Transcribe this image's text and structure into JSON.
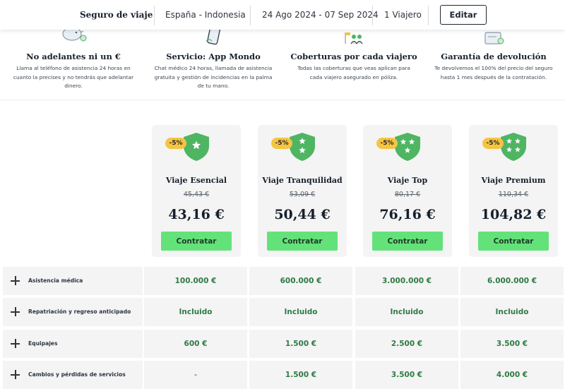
{
  "header": {
    "title": "Seguro de viaje",
    "destination": "España - Indonesia",
    "dates": "24 Ago 2024 - 07 Sep 2024",
    "travelers": "1  Viajero",
    "edit_label": "Editar"
  },
  "features": [
    {
      "icon": "piggy-bank-icon",
      "title": "No adelantes ni un €",
      "desc": "Llama al teléfono de asistencia 24 horas en cuanto la precises y no tendrás que adelantar dinero."
    },
    {
      "icon": "phone-icon",
      "title": "Servicio: App Mondo",
      "desc": "Chat médico 24 horas, llamada de asistencia gratuita y gestión de incidencias en la palma de tu mano."
    },
    {
      "icon": "travelers-icon",
      "title": "Coberturas por cada viajero",
      "desc": "Todas las coberturas que veas aplican para cada viajero asegurado en póliza."
    },
    {
      "icon": "refund-icon",
      "title": "Garantía de devolución",
      "desc": "Te devolvemos el 100% del precio del seguro hasta 1 mes después de la contratación."
    }
  ],
  "plans": [
    {
      "name": "Viaje Esencial",
      "badge": "-5%",
      "old_price": "45,43 €",
      "price": "43,16 €",
      "cta": "Contratar",
      "stars": 1
    },
    {
      "name": "Viaje Tranquilidad",
      "badge": "-5%",
      "old_price": "53,09 €",
      "price": "50,44 €",
      "cta": "Contratar",
      "stars": 2
    },
    {
      "name": "Viaje Top",
      "badge": "-5%",
      "old_price": "80,17 €",
      "price": "76,16 €",
      "cta": "Contratar",
      "stars": 3
    },
    {
      "name": "Viaje Premium",
      "badge": "-5%",
      "old_price": "110,34 €",
      "price": "104,82 €",
      "cta": "Contratar",
      "stars": 4
    }
  ],
  "coverages": [
    {
      "label": "Asistencia médica",
      "values": [
        "100.000 €",
        "600.000 €",
        "3.000.000 €",
        "6.000.000 €"
      ]
    },
    {
      "label": "Repatriación y regreso anticipado",
      "values": [
        "Incluido",
        "Incluido",
        "Incluido",
        "Incluido"
      ]
    },
    {
      "label": "Equipajes",
      "values": [
        "600 €",
        "1.500 €",
        "2.500 €",
        "3.500 €"
      ]
    },
    {
      "label": "Cambios y pérdidas de servicios",
      "values": [
        "-",
        "1.500 €",
        "3.500 €",
        "4.000 €"
      ]
    }
  ],
  "colors": {
    "accent_green": "#64e27a",
    "shield_green": "#4fb563",
    "value_green": "#2f7a45",
    "badge_yellow": "#f5c542",
    "card_bg": "#f4f4f4"
  }
}
